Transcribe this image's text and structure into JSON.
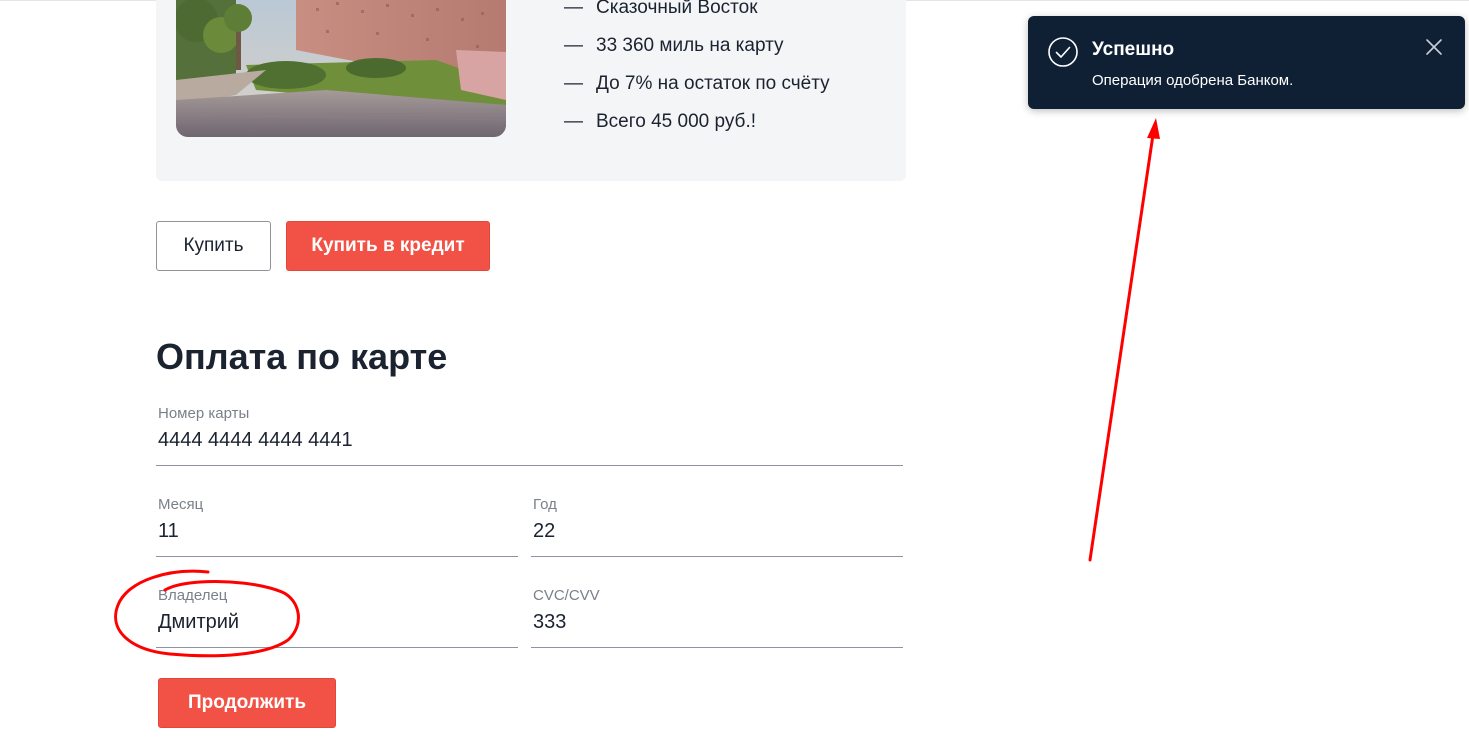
{
  "offer": {
    "features": [
      "Сказочный Восток",
      "33 360 миль на карту",
      "До 7% на остаток по счёту",
      "Всего 45 000 руб.!"
    ],
    "dash": "—"
  },
  "buttons": {
    "buy": "Купить",
    "buy_credit": "Купить в кредит",
    "continue": "Продолжить"
  },
  "payment": {
    "heading": "Оплата по карте",
    "card_number": {
      "label": "Номер карты",
      "value": "4444 4444 4444 4441"
    },
    "month": {
      "label": "Месяц",
      "value": "11"
    },
    "year": {
      "label": "Год",
      "value": "22"
    },
    "owner": {
      "label": "Владелец",
      "value": "Дмитрий"
    },
    "cvc": {
      "label": "CVC/CVV",
      "value": "333"
    }
  },
  "toast": {
    "title": "Успешно",
    "message": "Операция одобрена Банком.",
    "icon": "check-circle-icon",
    "close_icon": "close-icon"
  },
  "colors": {
    "accent": "#f25245",
    "toast_bg": "#0f2034",
    "annotation": "#ff0000"
  }
}
